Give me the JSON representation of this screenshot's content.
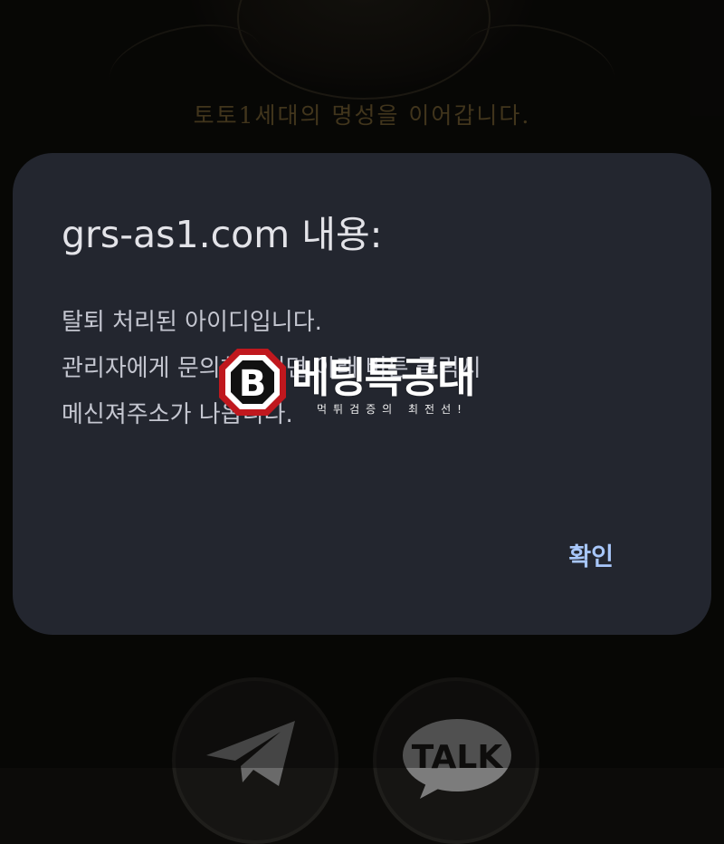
{
  "background": {
    "tagline": "토토1세대의 명성을 이어갑니다.",
    "buttons": [
      {
        "name": "telegram",
        "icon": "telegram-icon"
      },
      {
        "name": "kakao",
        "icon": "kakao-talk-icon",
        "label": "TALK"
      }
    ]
  },
  "dialog": {
    "title": "grs-as1.com 내용:",
    "message_lines": [
      "탈퇴 처리된 아이디입니다.",
      "관리자에게 문의하시려면 아래 버튼 클릭시",
      "메신져주소가 나옵니다."
    ],
    "ok_label": "확인"
  },
  "watermark": {
    "logo_letter": "B",
    "brand": "베팅특공대",
    "subtitle": "먹튀검증의 최전선!"
  },
  "colors": {
    "page_background": "#0c0b09",
    "dialog_background": "#23262f",
    "title_text": "#e3e3e8",
    "message_text": "#c4c6d0",
    "button_accent": "#a8c7fa",
    "tagline_gold": "#6f5a2f",
    "watermark_red": "#c0181e"
  }
}
